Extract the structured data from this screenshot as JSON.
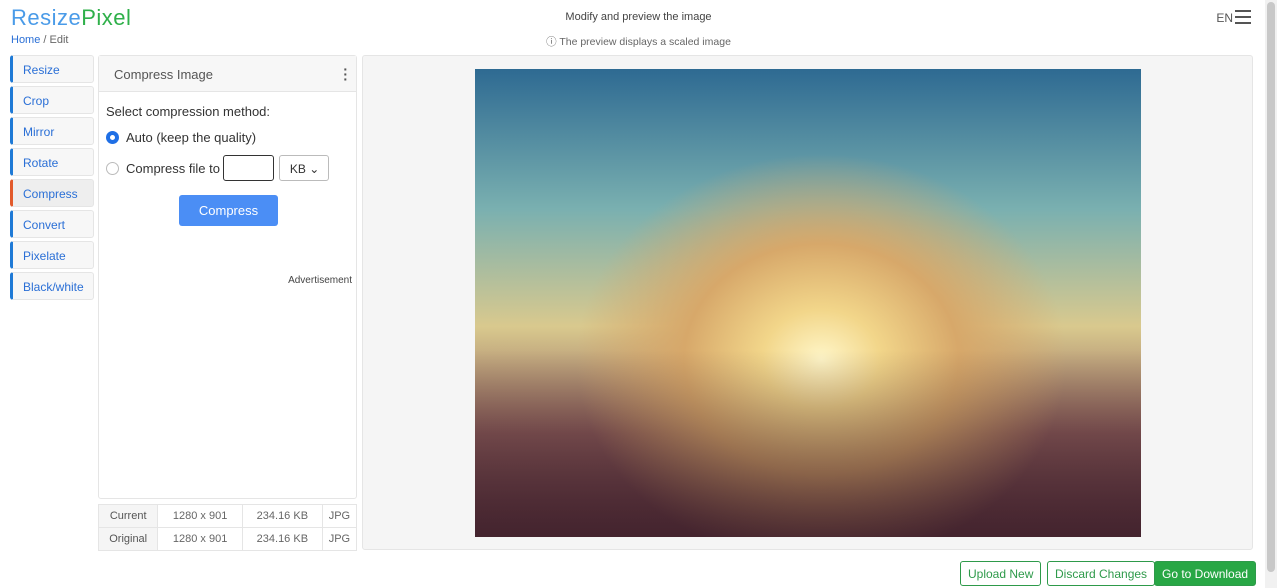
{
  "header": {
    "logo_a": "Resize",
    "logo_b": "Pixel",
    "crumb_home": "Home",
    "crumb_rest": " / Edit",
    "title": "Modify and preview the image",
    "subtitle": "ⓘ The preview displays a scaled image",
    "lang": "EN"
  },
  "sidebar": {
    "items": [
      {
        "label": "Resize"
      },
      {
        "label": "Crop"
      },
      {
        "label": "Mirror"
      },
      {
        "label": "Rotate"
      },
      {
        "label": "Compress"
      },
      {
        "label": "Convert"
      },
      {
        "label": "Pixelate"
      },
      {
        "label": "Black/white"
      }
    ]
  },
  "panel": {
    "title": "Compress Image",
    "method_label": "Select compression method:",
    "opt_auto": "Auto (keep the quality)",
    "opt_file": "Compress file to",
    "input_value": "",
    "unit": "KB",
    "button": "Compress",
    "ad": "Advertisement"
  },
  "info": {
    "rows": [
      {
        "label": "Current",
        "dims": "1280 x 901",
        "size": "234.16 KB",
        "fmt": "JPG"
      },
      {
        "label": "Original",
        "dims": "1280 x 901",
        "size": "234.16 KB",
        "fmt": "JPG"
      }
    ]
  },
  "footer": {
    "upload": "Upload New",
    "discard": "Discard Changes",
    "download": "Go to Download"
  }
}
